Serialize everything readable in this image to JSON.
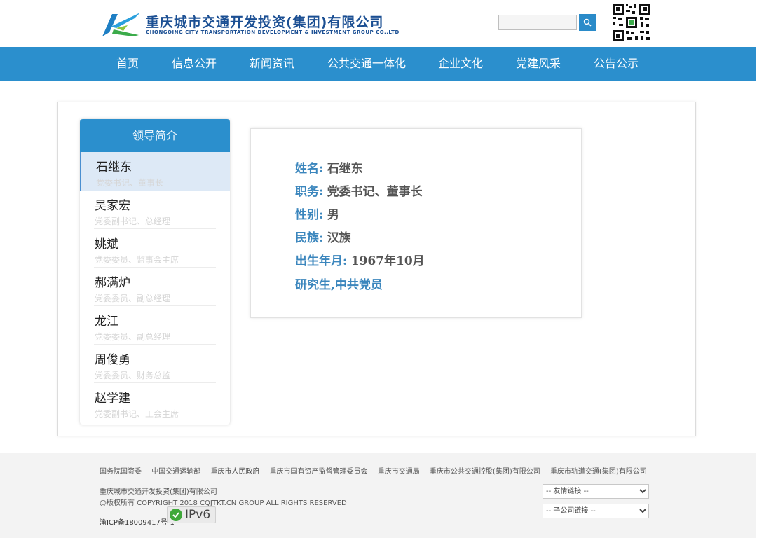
{
  "header": {
    "logo_cn": "重庆城市交通开发投资(集团)有限公司",
    "logo_en": "CHONGQING CITY TRANSPORTATION DEVELOPMENT & INVESTMENT GROUP CO.,LTD",
    "search_value": "",
    "search_icon": "magnifier-icon",
    "qr_icon": "qr-code-icon"
  },
  "nav": {
    "items": [
      "首页",
      "信息公开",
      "新闻资讯",
      "公共交通一体化",
      "企业文化",
      "党建风采",
      "公告公示"
    ]
  },
  "sidebar": {
    "title": "领导简介",
    "items": [
      {
        "name": "石继东",
        "title": "党委书记、董事长"
      },
      {
        "name": "吴家宏",
        "title": "党委副书记、总经理"
      },
      {
        "name": "姚斌",
        "title": "党委委员、监事会主席"
      },
      {
        "name": "郝满炉",
        "title": "党委委员、副总经理"
      },
      {
        "name": "龙江",
        "title": "党委委员、副总经理"
      },
      {
        "name": "周俊勇",
        "title": "党委委员、财务总监"
      },
      {
        "name": "赵学建",
        "title": "党委副书记、工会主席"
      }
    ]
  },
  "detail": {
    "name_label": "姓名:",
    "name_value": "石继东",
    "position_label": "职务:",
    "position_value": "党委书记、董事长",
    "gender_label": "性别:",
    "gender_value": "男",
    "ethnicity_label": "民族:",
    "ethnicity_value": "汉族",
    "birth_label": "出生年月:",
    "birth_value": "1967年10月",
    "education": "研究生,中共党员"
  },
  "footer": {
    "links": [
      "国务院国资委",
      "中国交通运输部",
      "重庆市人民政府",
      "重庆市国有资产监督管理委员会",
      "重庆市交通局",
      "重庆市公共交通控股(集团)有限公司",
      "重庆市轨道交通(集团)有限公司"
    ],
    "company": "重庆城市交通开发投资(集团)有限公司",
    "copyright": "@版权所有 COPYRIGHT 2018 CQJTKT.CN GROUP ALL RIGHTS RESERVED",
    "icp": "渝ICP备18009417号-1",
    "ipv6": "IPv6",
    "select_friend": "-- 友情链接 --",
    "select_sub": "-- 子公司链接 --"
  },
  "colors": {
    "nav_bg": "#2b8fcd",
    "brand_blue": "#1b4f93",
    "label_blue": "#3b86bd",
    "active_item_bg": "#dde9f6"
  }
}
